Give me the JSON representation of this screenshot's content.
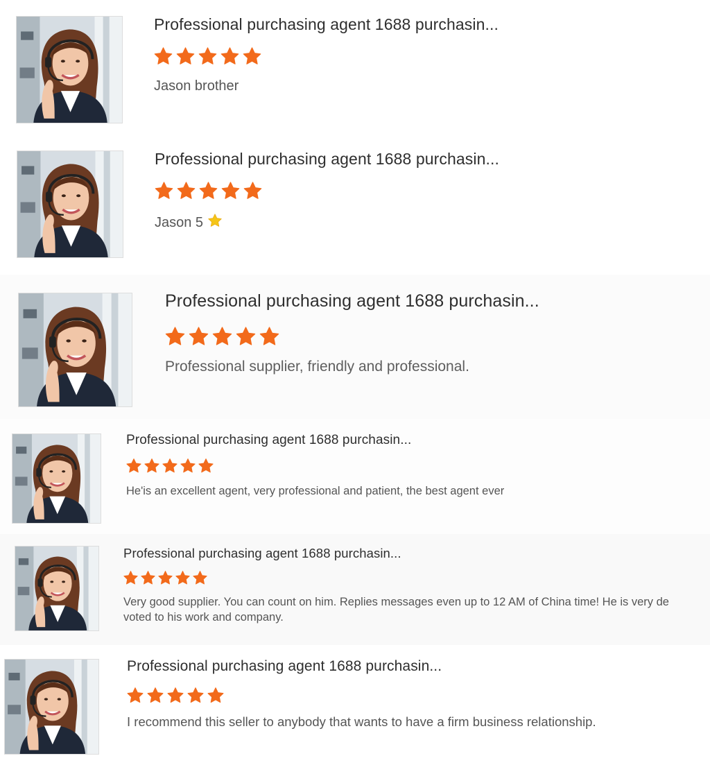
{
  "colors": {
    "star_fill": "#f26a1b",
    "mini_star_fill": "#f5c518",
    "title_text": "#2e2e2e",
    "comment_text": "#555555"
  },
  "reviews": [
    {
      "avatar_icon": "customer-service-agent-photo",
      "title": "Professional purchasing agent 1688 purchasin...",
      "rating": 5,
      "comment": "Jason brother"
    },
    {
      "avatar_icon": "customer-service-agent-photo",
      "title": "Professional purchasing agent 1688 purchasin...",
      "rating": 5,
      "comment": "Jason 5",
      "comment_emoji_icon": "star-emoji-icon"
    },
    {
      "avatar_icon": "customer-service-agent-photo",
      "title": "Professional purchasing agent 1688 purchasin...",
      "rating": 5,
      "comment": "Professional supplier, friendly and professional."
    },
    {
      "avatar_icon": "customer-service-agent-photo",
      "title": "Professional purchasing agent 1688 purchasin...",
      "rating": 5,
      "comment": "He'is an excellent agent, very professional and patient, the best agent ever"
    },
    {
      "avatar_icon": "customer-service-agent-photo",
      "title": "Professional purchasing agent 1688 purchasin...",
      "rating": 5,
      "comment": "Very good supplier. You can count on him. Replies messages even up to 12 AM of China time! He is very de voted to his work and company."
    },
    {
      "avatar_icon": "customer-service-agent-photo",
      "title": "Professional purchasing agent 1688 purchasin...",
      "rating": 5,
      "comment": "I recommend this seller to anybody that wants to have a firm business relationship."
    }
  ]
}
